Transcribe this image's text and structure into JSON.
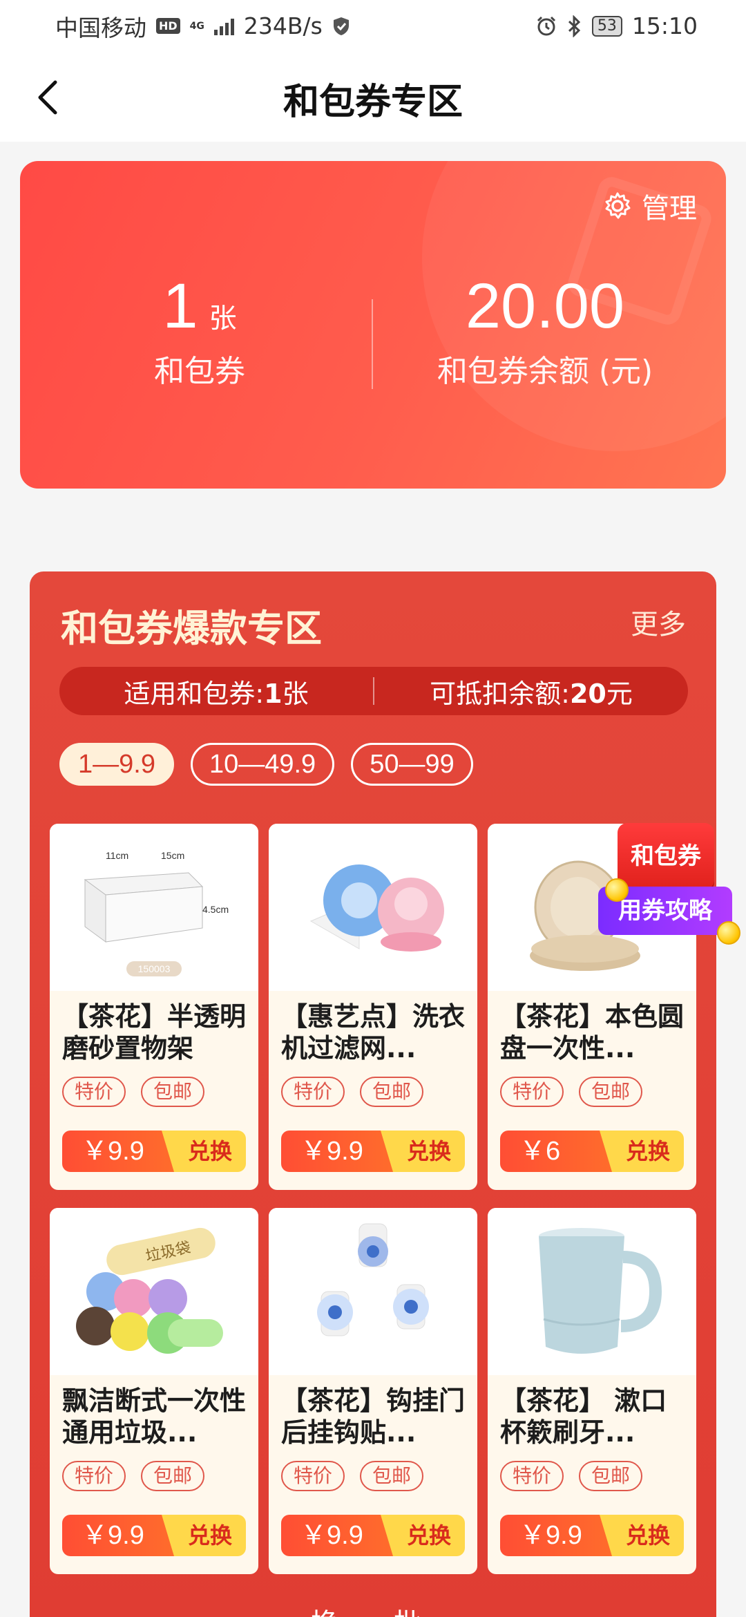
{
  "status_bar": {
    "carrier": "中国移动",
    "hd": "HD",
    "network": "4G",
    "speed": "234B/s",
    "battery": "53",
    "time": "15:10"
  },
  "nav": {
    "title": "和包券专区"
  },
  "summary": {
    "manage_label": "管理",
    "count_value": "1",
    "count_unit": "张",
    "count_label": "和包券",
    "balance_value": "20.00",
    "balance_label": "和包券余额 (元)"
  },
  "hot_zone": {
    "title": "和包券爆款专区",
    "more_label": "更多",
    "info_left_prefix": "适用和包券:",
    "info_left_value": "1",
    "info_left_suffix": "张",
    "info_right_prefix": "可抵扣余额:",
    "info_right_value": "20",
    "info_right_suffix": "元",
    "price_tabs": [
      {
        "label": "1—9.9",
        "active": true
      },
      {
        "label": "10—49.9",
        "active": false
      },
      {
        "label": "50—99",
        "active": false
      }
    ],
    "products": [
      {
        "name": "【茶花】半透明磨砂置物架",
        "tag1": "特价",
        "tag2": "包邮",
        "price": "￥9.9",
        "action": "兑换",
        "image": "storage-box"
      },
      {
        "name": "【惠艺点】洗衣机过滤网...",
        "tag1": "特价",
        "tag2": "包邮",
        "price": "￥9.9",
        "action": "兑换",
        "image": "laundry-filter"
      },
      {
        "name": "【茶花】本色圆盘一次性...",
        "tag1": "特价",
        "tag2": "包邮",
        "price": "￥6",
        "action": "兑换",
        "image": "paper-plates"
      },
      {
        "name": "飘洁断式一次性通用垃圾...",
        "tag1": "特价",
        "tag2": "包邮",
        "price": "￥9.9",
        "action": "兑换",
        "image": "trash-bag-rolls"
      },
      {
        "name": "【茶花】钩挂门后挂钩贴...",
        "tag1": "特价",
        "tag2": "包邮",
        "price": "￥9.9",
        "action": "兑换",
        "image": "wall-hooks"
      },
      {
        "name": "【茶花】 漱口杯簌刷牙...",
        "tag1": "特价",
        "tag2": "包邮",
        "price": "￥9.9",
        "action": "兑换",
        "image": "cup"
      }
    ],
    "refresh_label": "换一批"
  },
  "storage_box_labels": {
    "w": "11cm",
    "l": "15cm",
    "h": "4.5cm",
    "code": "150003"
  },
  "trash_bag_label": "垃圾袋",
  "float_badge": {
    "top": "和包券",
    "bottom": "用券攻略"
  },
  "colors": {
    "card_red": "#ff4a45",
    "zone_red": "#e4483b",
    "price_gold": "#ffd84a",
    "badge_purple": "#7b2cff"
  }
}
